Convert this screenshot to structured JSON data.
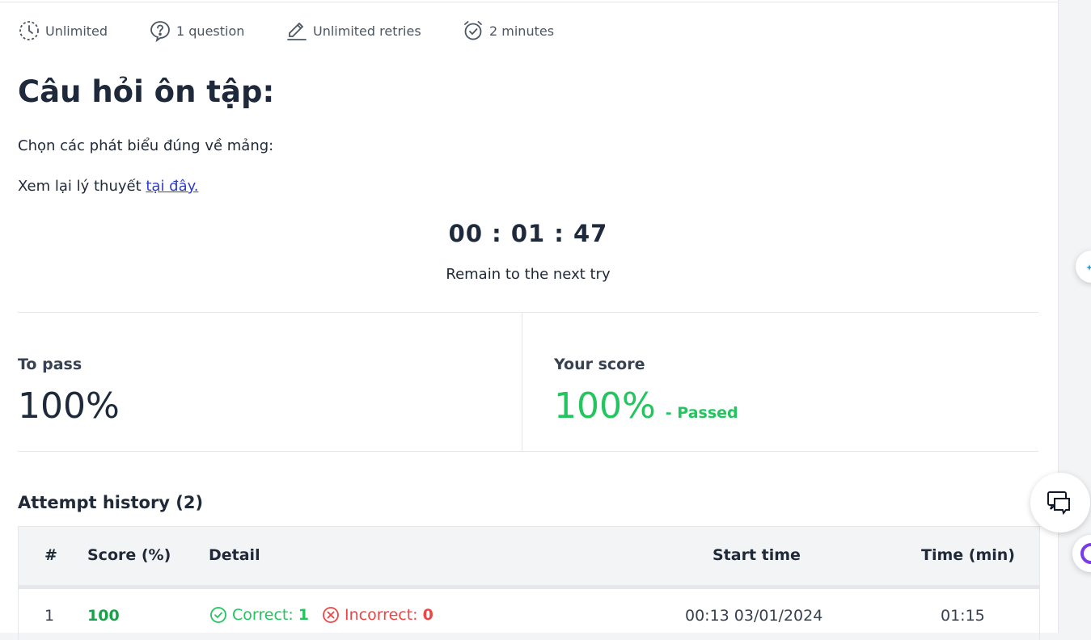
{
  "meta": {
    "time_limit": "Unlimited",
    "questions": "1 question",
    "retries": "Unlimited retries",
    "duration": "2 minutes"
  },
  "title": "Câu hỏi ôn tập:",
  "prompt": "Chọn các phát biểu đúng về mảng:",
  "review": {
    "text": "Xem lại lý thuyết ",
    "link": "tại đây."
  },
  "timer": {
    "value": "00 : 01 : 47",
    "label": "Remain to the next try"
  },
  "to_pass": {
    "label": "To pass",
    "value": "100%"
  },
  "your_score": {
    "label": "Your score",
    "value": "100%",
    "status": "- Passed"
  },
  "history": {
    "title": "Attempt history (2)",
    "columns": {
      "num": "#",
      "score": "Score (%)",
      "detail": "Detail",
      "start": "Start time",
      "time": "Time (min)"
    },
    "rows": [
      {
        "num": "1",
        "score": "100",
        "correct_label": "Correct:",
        "correct": "1",
        "incorrect_label": "Incorrect:",
        "incorrect": "0",
        "start": "00:13 03/01/2024",
        "time": "01:15"
      }
    ]
  },
  "colors": {
    "pass": "#22c55e",
    "fail": "#ef4444",
    "link": "#2f3ec9",
    "heading": "#1e293b"
  }
}
